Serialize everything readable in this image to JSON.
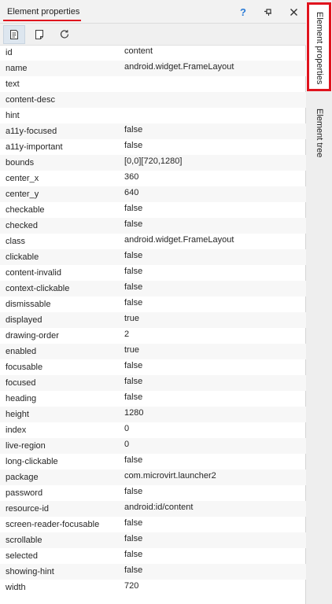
{
  "panel": {
    "title": "Element properties",
    "accent_color": "#e0141e",
    "help_label": "?",
    "pin_icon": "pin-icon",
    "close_icon": "close-icon"
  },
  "toolbar": {
    "buttons": [
      {
        "icon": "document-list-icon",
        "active": true
      },
      {
        "icon": "document-icon",
        "active": false
      },
      {
        "icon": "refresh-icon",
        "active": false
      }
    ]
  },
  "properties": [
    {
      "key": "id",
      "value": "content"
    },
    {
      "key": "name",
      "value": "android.widget.FrameLayout"
    },
    {
      "key": "text",
      "value": ""
    },
    {
      "key": "content-desc",
      "value": ""
    },
    {
      "key": "hint",
      "value": ""
    },
    {
      "key": "a11y-focused",
      "value": "false"
    },
    {
      "key": "a11y-important",
      "value": "false"
    },
    {
      "key": "bounds",
      "value": "[0,0][720,1280]"
    },
    {
      "key": "center_x",
      "value": "360"
    },
    {
      "key": "center_y",
      "value": "640"
    },
    {
      "key": "checkable",
      "value": "false"
    },
    {
      "key": "checked",
      "value": "false"
    },
    {
      "key": "class",
      "value": "android.widget.FrameLayout"
    },
    {
      "key": "clickable",
      "value": "false"
    },
    {
      "key": "content-invalid",
      "value": "false"
    },
    {
      "key": "context-clickable",
      "value": "false"
    },
    {
      "key": "dismissable",
      "value": "false"
    },
    {
      "key": "displayed",
      "value": "true"
    },
    {
      "key": "drawing-order",
      "value": "2"
    },
    {
      "key": "enabled",
      "value": "true"
    },
    {
      "key": "focusable",
      "value": "false"
    },
    {
      "key": "focused",
      "value": "false"
    },
    {
      "key": "heading",
      "value": "false"
    },
    {
      "key": "height",
      "value": "1280"
    },
    {
      "key": "index",
      "value": "0"
    },
    {
      "key": "live-region",
      "value": "0"
    },
    {
      "key": "long-clickable",
      "value": "false"
    },
    {
      "key": "package",
      "value": "com.microvirt.launcher2"
    },
    {
      "key": "password",
      "value": "false"
    },
    {
      "key": "resource-id",
      "value": "android:id/content"
    },
    {
      "key": "screen-reader-focusable",
      "value": "false"
    },
    {
      "key": "scrollable",
      "value": "false"
    },
    {
      "key": "selected",
      "value": "false"
    },
    {
      "key": "showing-hint",
      "value": "false"
    },
    {
      "key": "width",
      "value": "720"
    }
  ],
  "sidebar": {
    "tabs": [
      {
        "label": "Element properties",
        "active": true
      },
      {
        "label": "Element tree",
        "active": false
      }
    ]
  }
}
